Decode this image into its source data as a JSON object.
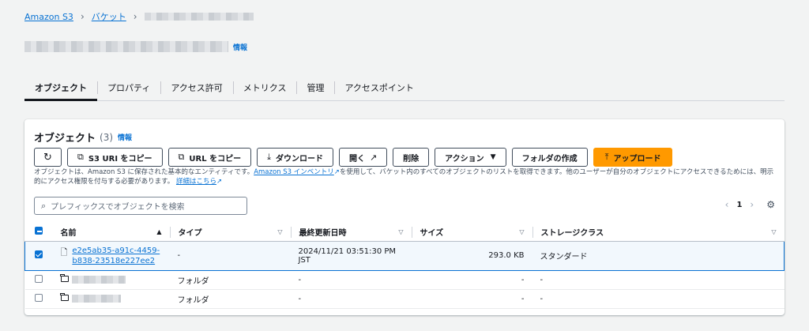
{
  "breadcrumb": {
    "root": "Amazon S3",
    "buckets": "バケット"
  },
  "bucket": {
    "info_label": "情報"
  },
  "tabs": [
    "オブジェクト",
    "プロパティ",
    "アクセス許可",
    "メトリクス",
    "管理",
    "アクセスポイント"
  ],
  "panel": {
    "title": "オブジェクト",
    "count": "(3)",
    "info_label": "情報",
    "toolbar": {
      "refresh_icon": "refresh-icon",
      "copy_s3_uri": "S3 URI をコピー",
      "copy_url": "URL をコピー",
      "download": "ダウンロード",
      "open": "開く",
      "delete": "削除",
      "actions": "アクション",
      "create_folder": "フォルダの作成",
      "upload": "アップロード"
    },
    "description": {
      "part1": "オブジェクトは、Amazon S3 に保存された基本的なエンティティです。",
      "inventory_link": "Amazon S3 インベントリ",
      "part2": "を使用して、バケット内のすべてのオブジェクトのリストを取得できます。他のユーザーが自分のオブジェクトにアクセスできるためには、明示的にアクセス権限を付与する必要があります。",
      "details_link": "詳細はこちら"
    },
    "search_placeholder": "プレフィックスでオブジェクトを検索",
    "pager": {
      "current_page": "1"
    }
  },
  "table": {
    "headers": [
      "名前",
      "タイプ",
      "最終更新日時",
      "サイズ",
      "ストレージクラス"
    ],
    "rows": [
      {
        "name_line1": "e2e5ab35-a91c-4459-",
        "name_line2": "b838-23518e227ee2",
        "type": "-",
        "modified_line1": "2024/11/21 03:51:30 PM",
        "modified_line2": "JST",
        "size": "293.0 KB",
        "storage": "スタンダード",
        "selected": true
      },
      {
        "type": "フォルダ",
        "modified": "-",
        "size": "-",
        "storage": "-",
        "selected": false
      },
      {
        "type": "フォルダ",
        "modified": "-",
        "size": "-",
        "storage": "-",
        "selected": false
      }
    ]
  },
  "colors": {
    "accent": "#0972d3",
    "primary_button": "#ff9900"
  }
}
